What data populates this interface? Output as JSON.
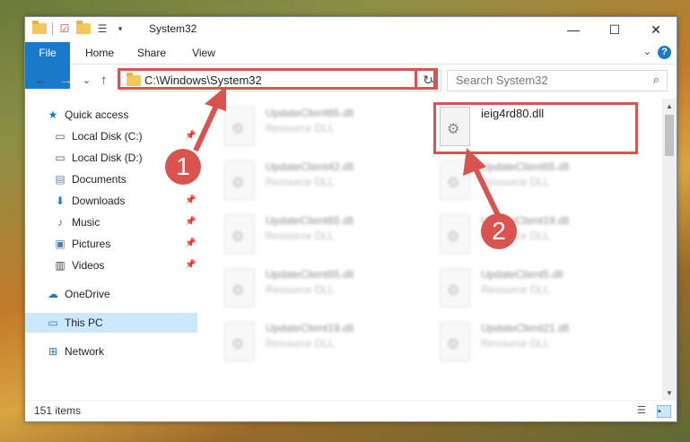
{
  "window": {
    "title": "System32",
    "controls": {
      "minimize": "—",
      "maximize": "☐",
      "close": "✕"
    }
  },
  "ribbon": {
    "tabs": [
      "File",
      "Home",
      "Share",
      "View"
    ],
    "help": "?"
  },
  "navigation": {
    "back": "←",
    "forward": "→",
    "recent": "⌄",
    "up": "↑",
    "address": "C:\\Windows\\System32",
    "refresh": "↻",
    "search_placeholder": "Search System32"
  },
  "sidebar": {
    "items": [
      {
        "label": "Quick access",
        "icon": "star-icon"
      },
      {
        "label": "Local Disk (C:)",
        "icon": "drive-icon",
        "pinned": true
      },
      {
        "label": "Local Disk (D:)",
        "icon": "drive-icon",
        "pinned": true
      },
      {
        "label": "Documents",
        "icon": "documents-icon",
        "pinned": true
      },
      {
        "label": "Downloads",
        "icon": "download-icon",
        "pinned": true
      },
      {
        "label": "Music",
        "icon": "music-icon",
        "pinned": true
      },
      {
        "label": "Pictures",
        "icon": "pictures-icon",
        "pinned": true
      },
      {
        "label": "Videos",
        "icon": "videos-icon",
        "pinned": true
      },
      {
        "label": "OneDrive",
        "icon": "cloud-icon"
      },
      {
        "label": "This PC",
        "icon": "pc-icon",
        "selected": true
      },
      {
        "label": "Network",
        "icon": "network-icon"
      }
    ]
  },
  "files": {
    "left_column": [
      {
        "name": "UpdateClient65.dll",
        "type": "Resource DLL"
      },
      {
        "name": "UpdateClient42.dll",
        "type": "Resource DLL"
      },
      {
        "name": "UpdateClient65.dll",
        "type": "Resource DLL"
      },
      {
        "name": "UpdateClient65.dll",
        "type": "Resource DLL"
      },
      {
        "name": "UpdateClient19.dll",
        "type": "Resource DLL"
      }
    ],
    "right_column": [
      {
        "name": "ieig4rd80.dll",
        "type": ""
      },
      {
        "name": "UpdateClient65.dll",
        "type": "Resource DLL"
      },
      {
        "name": "UpdateClient19.dll",
        "type": "Resource DLL"
      },
      {
        "name": "UpdateClient5.dll",
        "type": "Resource DLL"
      },
      {
        "name": "UpdateClient21.dll",
        "type": "Resource DLL"
      }
    ]
  },
  "status": {
    "item_count": "151 items"
  },
  "annotations": {
    "badge1": "1",
    "badge2": "2",
    "color": "#d9534f"
  }
}
